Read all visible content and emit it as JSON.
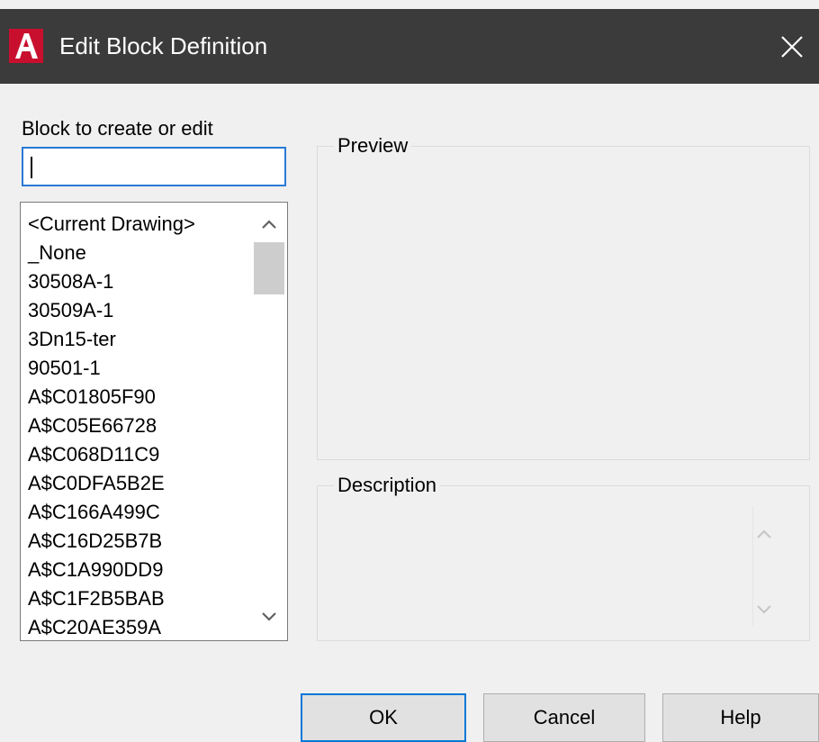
{
  "window": {
    "title": "Edit Block Definition",
    "title_bar_color": "#3b3b3b",
    "app_icon": "autocad-logo-icon",
    "close_icon": "close-icon"
  },
  "block_field": {
    "label": "Block to create or edit",
    "value": ""
  },
  "block_list": {
    "items": [
      "<Current Drawing>",
      "_None",
      "30508A-1",
      "30509A-1",
      "3Dn15-ter",
      "90501-1",
      "A$C01805F90",
      "A$C05E66728",
      "A$C068D11C9",
      "A$C0DFA5B2E",
      "A$C166A499C",
      "A$C16D25B7B",
      "A$C1A990DD9",
      "A$C1F2B5BAB",
      "A$C20AE359A"
    ],
    "scroll_up_icon": "chevron-up-icon",
    "scroll_down_icon": "chevron-down-icon"
  },
  "preview": {
    "label": "Preview"
  },
  "description": {
    "label": "Description",
    "text": ""
  },
  "buttons": {
    "ok": "OK",
    "cancel": "Cancel",
    "help": "Help"
  },
  "colors": {
    "accent": "#0078d7",
    "dialog_bg": "#f0f0f0",
    "app_icon_red": "#c8102e"
  }
}
